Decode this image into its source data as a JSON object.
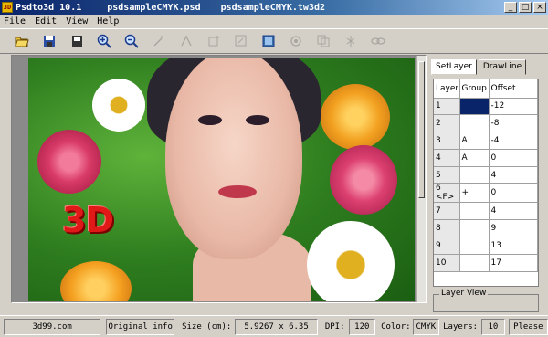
{
  "window": {
    "app_title": "Psdto3d 10.1",
    "file1": "psdsampleCMYK.psd",
    "file2": "psdsampleCMYK.tw3d2",
    "controls": {
      "minimize": "_",
      "maximize": "□",
      "close": "×"
    }
  },
  "menu": {
    "items": [
      "File",
      "Edit",
      "View",
      "Help"
    ]
  },
  "toolbar": {
    "icons": [
      "open-icon",
      "save-icon",
      "save-as-icon",
      "zoom-in-icon",
      "zoom-out-icon",
      "wand-icon",
      "select-icon",
      "layer-add-icon",
      "layer-edit-icon",
      "image-icon",
      "circle-icon",
      "copy-icon",
      "light-icon",
      "link-icon"
    ]
  },
  "canvas": {
    "logo_text": "3D"
  },
  "panel": {
    "tabs": [
      "SetLayer",
      "DrawLine"
    ],
    "active_tab": "SetLayer",
    "columns": [
      "Layer",
      "Group",
      "Offset"
    ],
    "rows": [
      {
        "layer": "1",
        "group": "",
        "offset": "-12",
        "selected": true
      },
      {
        "layer": "2",
        "group": "",
        "offset": "-8"
      },
      {
        "layer": "3",
        "group": "A",
        "offset": "-4"
      },
      {
        "layer": "4",
        "group": "A",
        "offset": "0"
      },
      {
        "layer": "5",
        "group": "",
        "offset": "4"
      },
      {
        "layer": "6 <F>",
        "group": "+",
        "offset": "0"
      },
      {
        "layer": "7",
        "group": "",
        "offset": "4"
      },
      {
        "layer": "8",
        "group": "",
        "offset": "9"
      },
      {
        "layer": "9",
        "group": "",
        "offset": "13"
      },
      {
        "layer": "10",
        "group": "",
        "offset": "17"
      }
    ],
    "layer_view_label": "Layer View"
  },
  "status": {
    "site": "3d99.com",
    "original_info": "Original info",
    "size_label": "Size (cm):",
    "size_value": "5.9267 x 6.35",
    "dpi_label": "DPI:",
    "dpi_value": "120",
    "color_label": "Color:",
    "color_value": "CMYK",
    "layers_label": "Layers:",
    "layers_value": "10",
    "message": "Please"
  },
  "colors": {
    "selected_cell": "#0a246a",
    "title_start": "#0a246a",
    "title_end": "#a6caf0"
  }
}
